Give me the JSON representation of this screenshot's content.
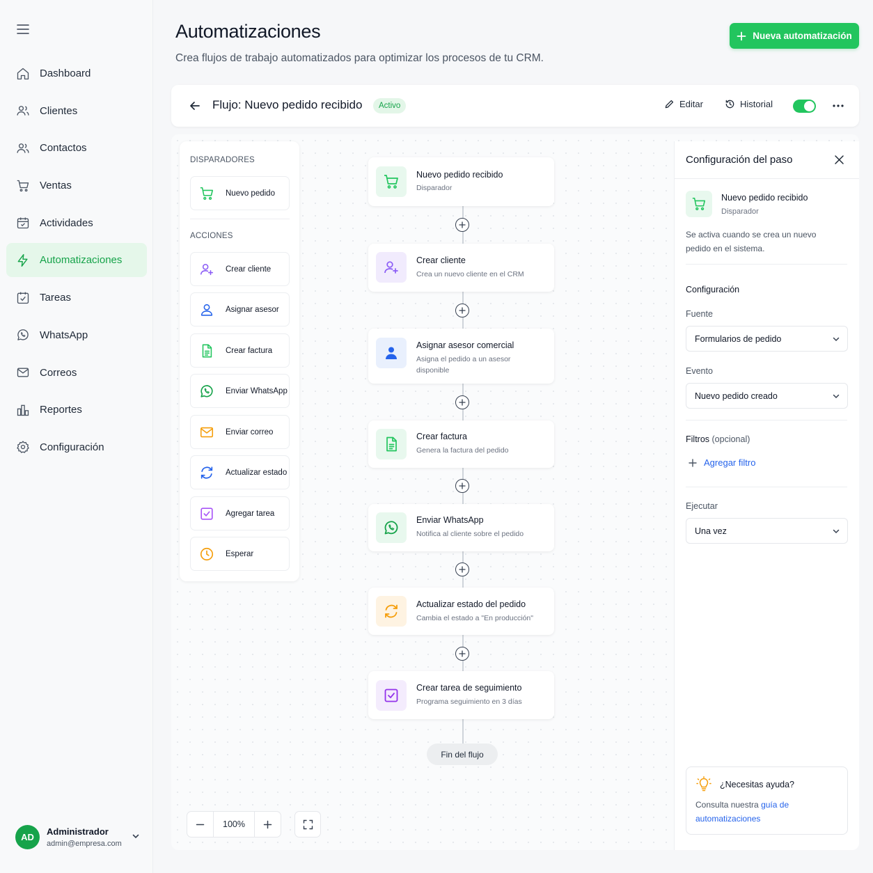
{
  "sidebar": {
    "items": [
      {
        "label": "Dashboard",
        "icon": "home-icon"
      },
      {
        "label": "Clientes",
        "icon": "users-icon"
      },
      {
        "label": "Contactos",
        "icon": "contacts-icon"
      },
      {
        "label": "Ventas",
        "icon": "cart-icon"
      },
      {
        "label": "Actividades",
        "icon": "calendar-icon"
      },
      {
        "label": "Automatizaciones",
        "icon": "bolt-icon",
        "active": true
      },
      {
        "label": "Tareas",
        "icon": "check-square-icon"
      },
      {
        "label": "WhatsApp",
        "icon": "whatsapp-icon"
      },
      {
        "label": "Correos",
        "icon": "mail-icon"
      },
      {
        "label": "Reportes",
        "icon": "chart-icon"
      },
      {
        "label": "Configuración",
        "icon": "gear-icon"
      }
    ],
    "user": {
      "initials": "AD",
      "name": "Administrador",
      "email": "admin@empresa.com"
    }
  },
  "header": {
    "title": "Automatizaciones",
    "subtitle": "Crea flujos de trabajo automatizados para optimizar los procesos de tu CRM.",
    "new_button": "Nueva automatización"
  },
  "flowbar": {
    "title": "Flujo: Nuevo pedido recibido",
    "status": "Activo",
    "edit_label": "Editar",
    "history_label": "Historial",
    "toggle_on": true
  },
  "palette": {
    "triggers_heading": "DISPARADORES",
    "triggers": [
      {
        "label": "Nuevo pedido",
        "icon": "cart-icon"
      }
    ],
    "actions_heading": "ACCIONES",
    "actions": [
      {
        "label": "Crear cliente",
        "icon": "user-plus-icon"
      },
      {
        "label": "Asignar asesor",
        "icon": "user-icon"
      },
      {
        "label": "Crear factura",
        "icon": "invoice-icon"
      },
      {
        "label": "Enviar WhatsApp",
        "icon": "whatsapp-icon"
      },
      {
        "label": "Enviar correo",
        "icon": "mail-icon"
      },
      {
        "label": "Actualizar estado",
        "icon": "refresh-icon"
      },
      {
        "label": "Agregar tarea",
        "icon": "check-square-icon"
      },
      {
        "label": "Esperar",
        "icon": "clock-icon"
      }
    ]
  },
  "flow": {
    "nodes": [
      {
        "title": "Nuevo pedido recibido",
        "desc": "Disparador",
        "icon": "cart-icon"
      },
      {
        "title": "Crear cliente",
        "desc": "Crea un nuevo cliente en el CRM",
        "icon": "user-plus-icon"
      },
      {
        "title": "Asignar asesor comercial",
        "desc": "Asigna el pedido a un asesor disponible",
        "icon": "user-icon"
      },
      {
        "title": "Crear factura",
        "desc": "Genera la factura del pedido",
        "icon": "invoice-icon"
      },
      {
        "title": "Enviar WhatsApp",
        "desc": "Notifica al cliente sobre el pedido",
        "icon": "whatsapp-icon"
      },
      {
        "title": "Actualizar estado del pedido",
        "desc": "Cambia el estado a \"En producción\"",
        "icon": "refresh-icon"
      },
      {
        "title": "Crear tarea de seguimiento",
        "desc": "Programa seguimiento en 3 días",
        "icon": "check-square-icon"
      }
    ],
    "end_label": "Fin del flujo"
  },
  "zoom": {
    "value": "100%"
  },
  "config": {
    "title": "Configuración del paso",
    "step_title": "Nuevo pedido recibido",
    "step_sub": "Disparador",
    "step_desc": "Se activa cuando se crea un nuevo pedido en el sistema.",
    "section": "Configuración",
    "source_label": "Fuente",
    "source_value": "Formularios de pedido",
    "event_label": "Evento",
    "event_value": "Nuevo pedido creado",
    "filters_label": "Filtros",
    "filters_optional": "(opcional)",
    "add_filter": "Agregar filtro",
    "execute_label": "Ejecutar",
    "execute_value": "Una vez",
    "help_title": "¿Necesitas ayuda?",
    "help_text": "Consulta nuestra",
    "help_link": "guía de automatizaciones"
  },
  "colors": {
    "accent": "#22c55e",
    "active_bg": "#e5f7ea",
    "link": "#2563eb"
  }
}
